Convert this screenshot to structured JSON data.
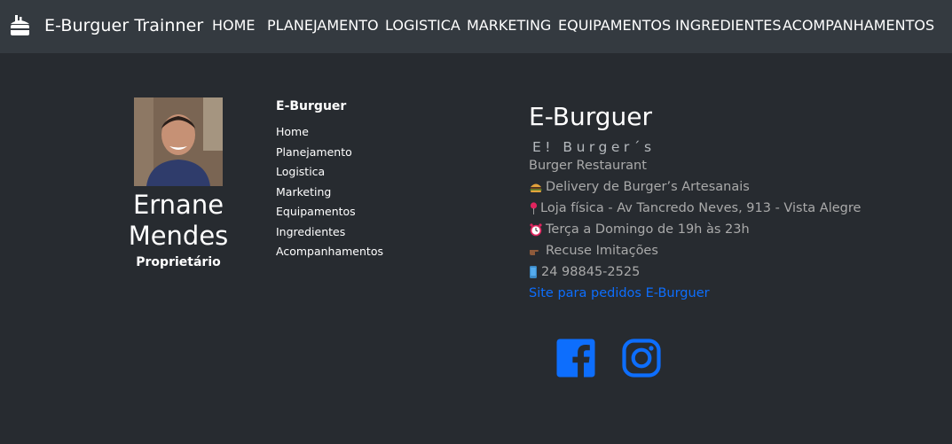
{
  "navbar": {
    "brand": "E-Burguer Trainner",
    "links": [
      "HOME",
      "PLANEJAMENTO",
      "LOGISTICA",
      "MARKETING",
      "EQUIPAMENTOS",
      "INGREDIENTES",
      "ACOMPANHAMENTOS"
    ]
  },
  "profile": {
    "name": "Ernane Mendes",
    "role": "Proprietário"
  },
  "site_links": {
    "title": "E-Burguer",
    "items": [
      "Home",
      "Planejamento",
      "Logistica",
      "Marketing",
      "Equipamentos",
      "Ingredientes",
      "Acompanhamentos"
    ]
  },
  "info": {
    "title": "E-Burguer",
    "tagline": "E! Burger´s",
    "category": "Burger Restaurant",
    "delivery": "Delivery de Burger’s Artesanais",
    "address": "Loja física - Av Tancredo Neves, 913 - Vista Alegre",
    "hours": "Terça a Domingo de 19h às 23h",
    "warning": "Recuse Imitações",
    "phone": "24 98845-2525",
    "order_link": "Site para pedidos E-Burguer"
  },
  "colors": {
    "background": "#272b30",
    "navbar": "#343a40",
    "link": "#0d6efd",
    "muted": "#aaaaaa"
  },
  "icons": [
    "hamburger-logo-icon",
    "facebook-icon",
    "instagram-icon",
    "burger-emoji-icon",
    "pin-emoji-icon",
    "clock-emoji-icon",
    "pointing-hand-emoji-icon",
    "phone-emoji-icon"
  ]
}
